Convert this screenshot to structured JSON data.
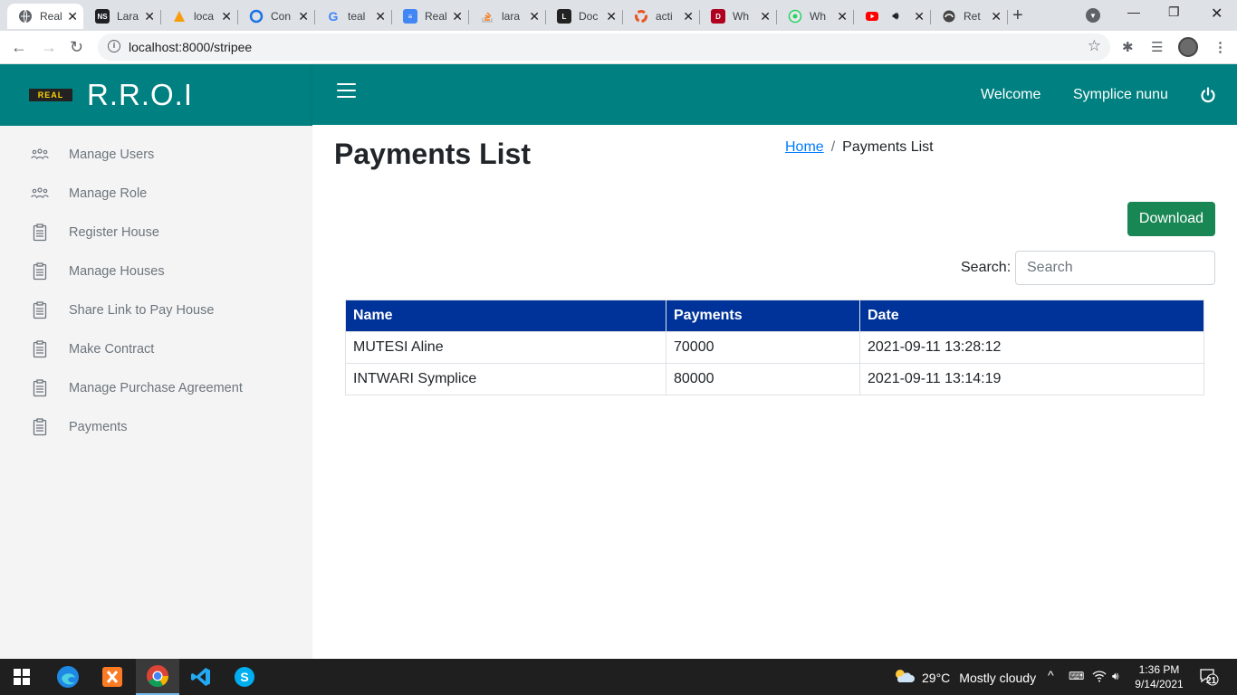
{
  "browser": {
    "tabs": [
      {
        "label": "Real",
        "active": true,
        "icon": "globe-icon",
        "color": "#5f6368"
      },
      {
        "label": "Lara",
        "icon": "ns-icon",
        "color": "#202124"
      },
      {
        "label": "loca",
        "icon": "pma-icon",
        "color": "#f89c0e"
      },
      {
        "label": "Con",
        "icon": "circle-icon",
        "color": "#1a73e8"
      },
      {
        "label": "teal",
        "icon": "google-icon",
        "color": "#ea4335"
      },
      {
        "label": "Real",
        "icon": "docs-icon",
        "color": "#4285f4"
      },
      {
        "label": "lara",
        "icon": "stackoverflow-icon",
        "color": "#f48024"
      },
      {
        "label": "Doc",
        "icon": "l-icon",
        "color": "#222222"
      },
      {
        "label": "acti",
        "icon": "ubuntu-icon",
        "color": "#e95420"
      },
      {
        "label": "Wh",
        "icon": "d-icon",
        "color": "#b00020"
      },
      {
        "label": "Wh",
        "icon": "whatsapp-icon",
        "color": "#25d366"
      },
      {
        "label": "",
        "icon": "youtube-icon",
        "color": "#ff0000"
      },
      {
        "label": "Ret",
        "icon": "edge-icon",
        "color": "#444444"
      }
    ],
    "url": "localhost:8000/stripee"
  },
  "app": {
    "brand_logo": "REAL",
    "brand_title": "R.R.O.I",
    "welcome": "Welcome",
    "username": "Symplice nunu",
    "menu": [
      {
        "label": "Manage Users",
        "icon": "users-icon"
      },
      {
        "label": "Manage Role",
        "icon": "users-icon"
      },
      {
        "label": "Register House",
        "icon": "clipboard-icon"
      },
      {
        "label": "Manage Houses",
        "icon": "clipboard-icon"
      },
      {
        "label": "Share Link to Pay House",
        "icon": "clipboard-icon"
      },
      {
        "label": "Make Contract",
        "icon": "clipboard-icon"
      },
      {
        "label": "Manage Purchase Agreement",
        "icon": "clipboard-icon"
      },
      {
        "label": "Payments",
        "icon": "clipboard-icon"
      }
    ],
    "page_title": "Payments List",
    "breadcrumb": {
      "home": "Home",
      "separator": "/",
      "current": "Payments List"
    },
    "download_label": "Download",
    "search": {
      "label": "Search:",
      "placeholder": "Search",
      "value": ""
    },
    "table": {
      "headers": [
        "Name",
        "Payments",
        "Date"
      ],
      "rows": [
        [
          "MUTESI Aline",
          "70000",
          "2021-09-11 13:28:12"
        ],
        [
          "INTWARI Symplice",
          "80000",
          "2021-09-11 13:14:19"
        ]
      ]
    },
    "colors": {
      "brand": "#008080",
      "table_header": "#003399",
      "download": "#198754"
    }
  },
  "taskbar": {
    "weather": {
      "temp": "29°C",
      "condition": "Mostly cloudy"
    },
    "time": "1:36 PM",
    "date": "9/14/2021",
    "notifications": "21"
  }
}
